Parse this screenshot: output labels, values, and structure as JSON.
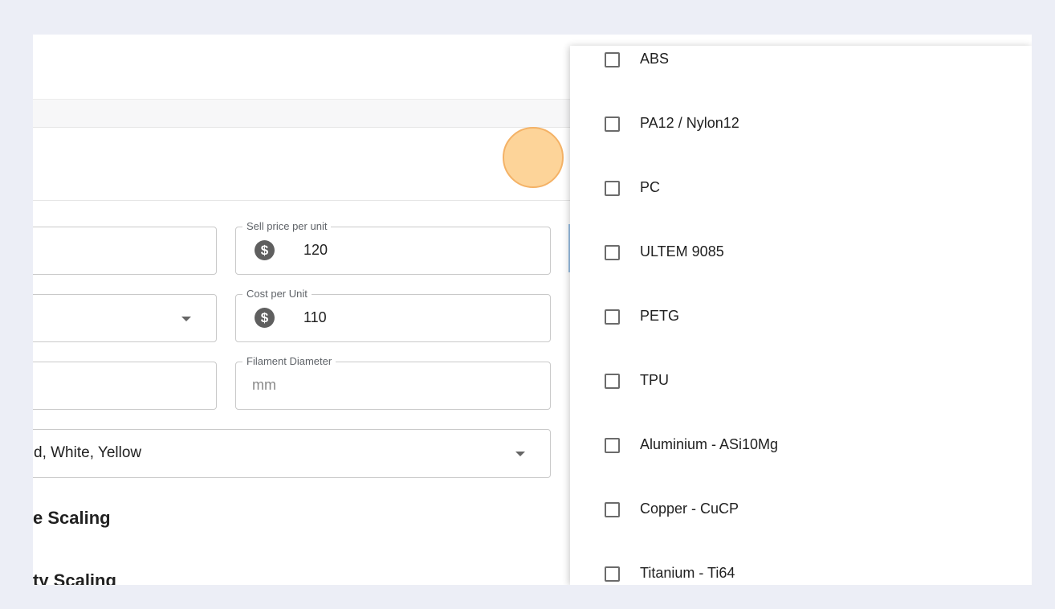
{
  "form": {
    "sell_price": {
      "label": "Sell price per unit",
      "value": "120",
      "icon": "dollar-icon"
    },
    "cost": {
      "label": "Cost per Unit",
      "value": "110",
      "icon": "dollar-icon"
    },
    "filament": {
      "label": "Filament Diameter",
      "placeholder": "mm"
    },
    "colors_value": "d, White, Yellow",
    "section1": "e Scaling",
    "section2": "ty Scaling"
  },
  "materials_menu": {
    "options": [
      {
        "label": "ABS",
        "checked": false
      },
      {
        "label": "PA12 / Nylon12",
        "checked": false
      },
      {
        "label": "PC",
        "checked": false
      },
      {
        "label": "ULTEM 9085",
        "checked": false
      },
      {
        "label": "PETG",
        "checked": false
      },
      {
        "label": "TPU",
        "checked": false
      },
      {
        "label": "Aluminium - ASi10Mg",
        "checked": false
      },
      {
        "label": "Copper - CuCP",
        "checked": false
      },
      {
        "label": "Titanium - Ti64",
        "checked": false
      }
    ]
  },
  "colors": {
    "background": "#eceef6",
    "click_indicator": "#fdcd87"
  }
}
